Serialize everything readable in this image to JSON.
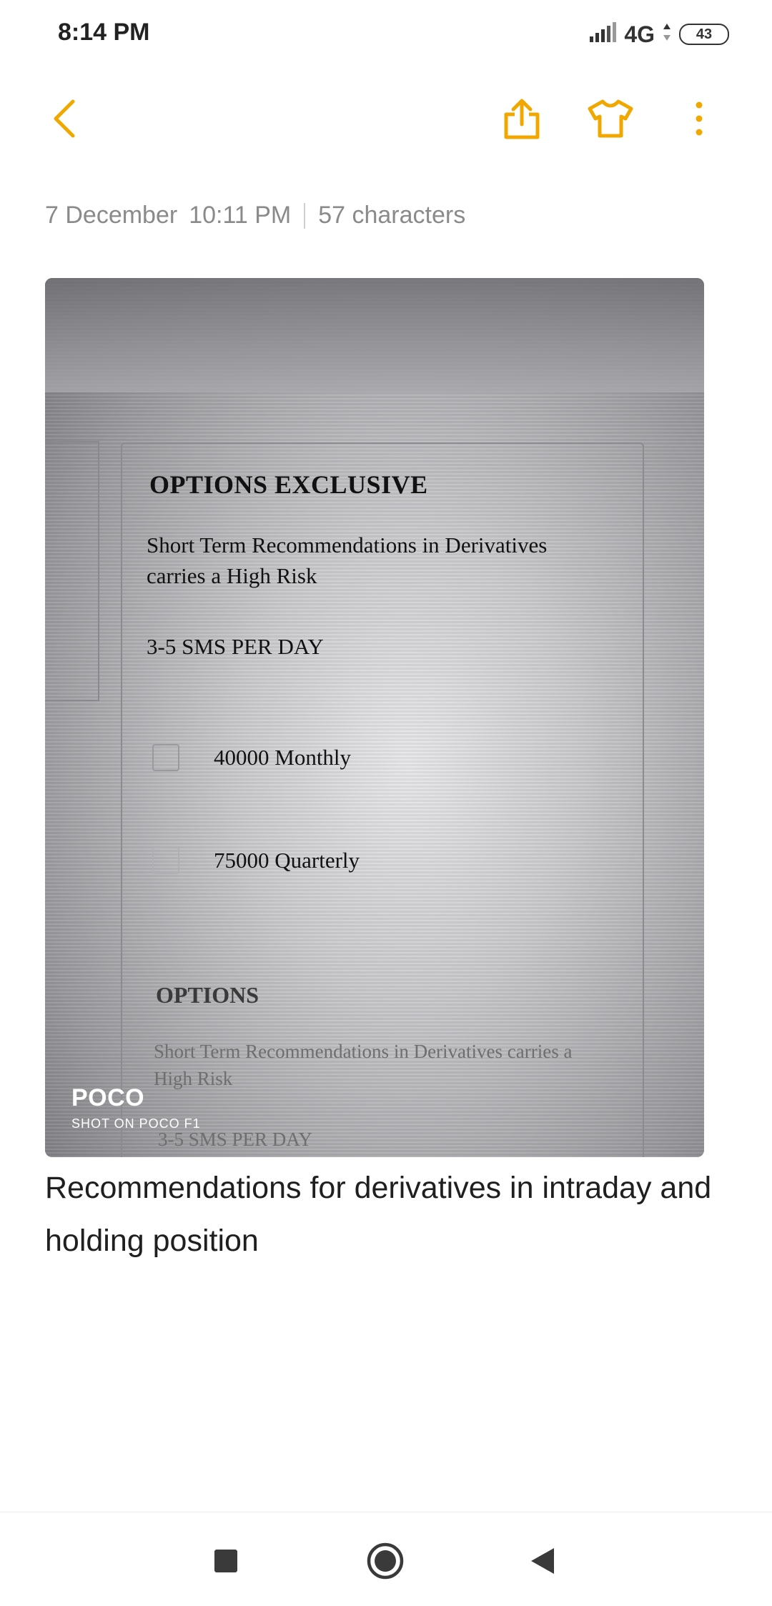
{
  "status_bar": {
    "time": "8:14 PM",
    "network": "4G",
    "battery": "43"
  },
  "toolbar": {
    "back_icon": "chevron-left-icon",
    "share_icon": "share-icon",
    "theme_icon": "tshirt-icon",
    "more_icon": "more-vertical-icon",
    "accent_color": "#f0a800"
  },
  "note": {
    "date": "7 December",
    "time": "10:11 PM",
    "char_count": "57 characters",
    "text": "Recommendations for derivatives in intraday and holding position"
  },
  "photo": {
    "card_title": "OPTIONS EXCLUSIVE",
    "card_description": "Short Term Recommendations in Derivatives carries a High Risk",
    "card_sms": "3-5 SMS PER DAY",
    "option_1": "40000 Monthly",
    "option_2": "75000 Quarterly",
    "card2_title": "OPTIONS",
    "card2_description": "Short Term Recommendations in Derivatives carries a High Risk",
    "card2_sms": "3-5 SMS PER DAY",
    "watermark_brand": "POCO",
    "watermark_sub": "SHOT ON POCO F1"
  },
  "nav_bar": {
    "recents_icon": "square-icon",
    "home_icon": "circle-icon",
    "back_icon": "triangle-back-icon"
  }
}
